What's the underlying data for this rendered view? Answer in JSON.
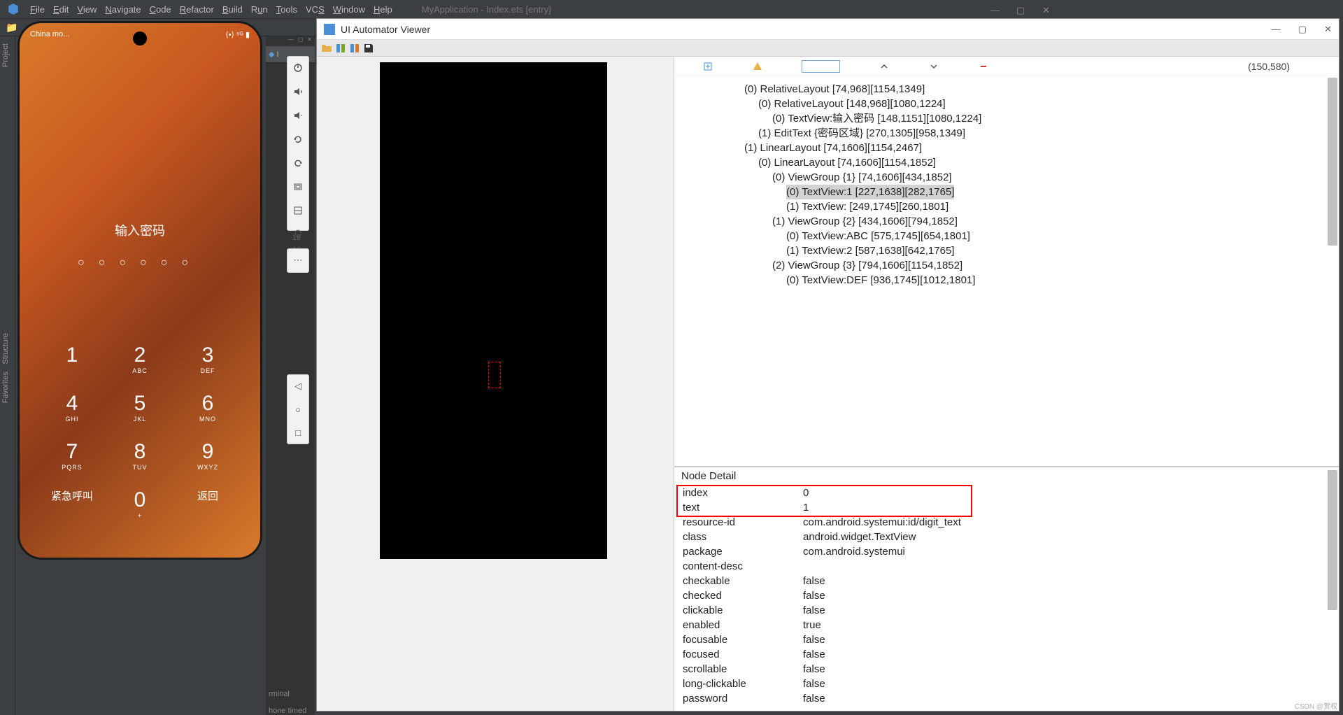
{
  "menubar": {
    "items": [
      "File",
      "Edit",
      "View",
      "Navigate",
      "Code",
      "Refactor",
      "Build",
      "Run",
      "Tools",
      "VCS",
      "Window",
      "Help"
    ],
    "title": "MyApplication - Index.ets [entry]"
  },
  "left_rail": {
    "project": "Project",
    "structure": "Structure",
    "favorites": "Favorites"
  },
  "phone": {
    "carrier": "China mo...",
    "pwd_label": "输入密码",
    "keys": [
      [
        {
          "n": "1",
          "l": ""
        },
        {
          "n": "2",
          "l": "ABC"
        },
        {
          "n": "3",
          "l": "DEF"
        }
      ],
      [
        {
          "n": "4",
          "l": "GHI"
        },
        {
          "n": "5",
          "l": "JKL"
        },
        {
          "n": "6",
          "l": "MNO"
        }
      ],
      [
        {
          "n": "7",
          "l": "PQRS"
        },
        {
          "n": "8",
          "l": "TUV"
        },
        {
          "n": "9",
          "l": "WXYZ"
        }
      ]
    ],
    "emergency": "紧急呼叫",
    "zero": "0",
    "zero_sub": "+",
    "back": "返回"
  },
  "gutter": {
    "file_tab_partial": "I",
    "bottom_lines": [
      "rminal",
      "hone timed"
    ]
  },
  "ui_auto": {
    "title": "UI Automator Viewer",
    "coords": "(150,580)",
    "tree": [
      {
        "indent": 1,
        "text": "(0) RelativeLayout [74,968][1154,1349]"
      },
      {
        "indent": 2,
        "text": "(0) RelativeLayout [148,968][1080,1224]"
      },
      {
        "indent": 3,
        "text": "(0) TextView:输入密码 [148,1151][1080,1224]"
      },
      {
        "indent": 2,
        "text": "(1) EditText {密码区域} [270,1305][958,1349]"
      },
      {
        "indent": 1,
        "text": "(1) LinearLayout [74,1606][1154,2467]"
      },
      {
        "indent": 2,
        "text": "(0) LinearLayout [74,1606][1154,1852]"
      },
      {
        "indent": 3,
        "text": "(0) ViewGroup {1} [74,1606][434,1852]"
      },
      {
        "indent": 4,
        "text": "(0) TextView:1 [227,1638][282,1765]",
        "sel": true
      },
      {
        "indent": 4,
        "text": "(1) TextView:  [249,1745][260,1801]"
      },
      {
        "indent": 3,
        "text": "(1) ViewGroup {2} [434,1606][794,1852]"
      },
      {
        "indent": 4,
        "text": "(0) TextView:ABC [575,1745][654,1801]"
      },
      {
        "indent": 4,
        "text": "(1) TextView:2 [587,1638][642,1765]"
      },
      {
        "indent": 3,
        "text": "(2) ViewGroup {3} [794,1606][1154,1852]"
      },
      {
        "indent": 4,
        "text": "(0) TextView:DEF [936,1745][1012,1801]"
      }
    ],
    "detail_header": "Node Detail",
    "details": [
      {
        "k": "index",
        "v": "0"
      },
      {
        "k": "text",
        "v": "1"
      },
      {
        "k": "resource-id",
        "v": "com.android.systemui:id/digit_text"
      },
      {
        "k": "class",
        "v": "android.widget.TextView"
      },
      {
        "k": "package",
        "v": "com.android.systemui"
      },
      {
        "k": "content-desc",
        "v": ""
      },
      {
        "k": "checkable",
        "v": "false"
      },
      {
        "k": "checked",
        "v": "false"
      },
      {
        "k": "clickable",
        "v": "false"
      },
      {
        "k": "enabled",
        "v": "true"
      },
      {
        "k": "focusable",
        "v": "false"
      },
      {
        "k": "focused",
        "v": "false"
      },
      {
        "k": "scrollable",
        "v": "false"
      },
      {
        "k": "long-clickable",
        "v": "false"
      },
      {
        "k": "password",
        "v": "false"
      }
    ]
  },
  "watermark": "CSDN @贺权"
}
